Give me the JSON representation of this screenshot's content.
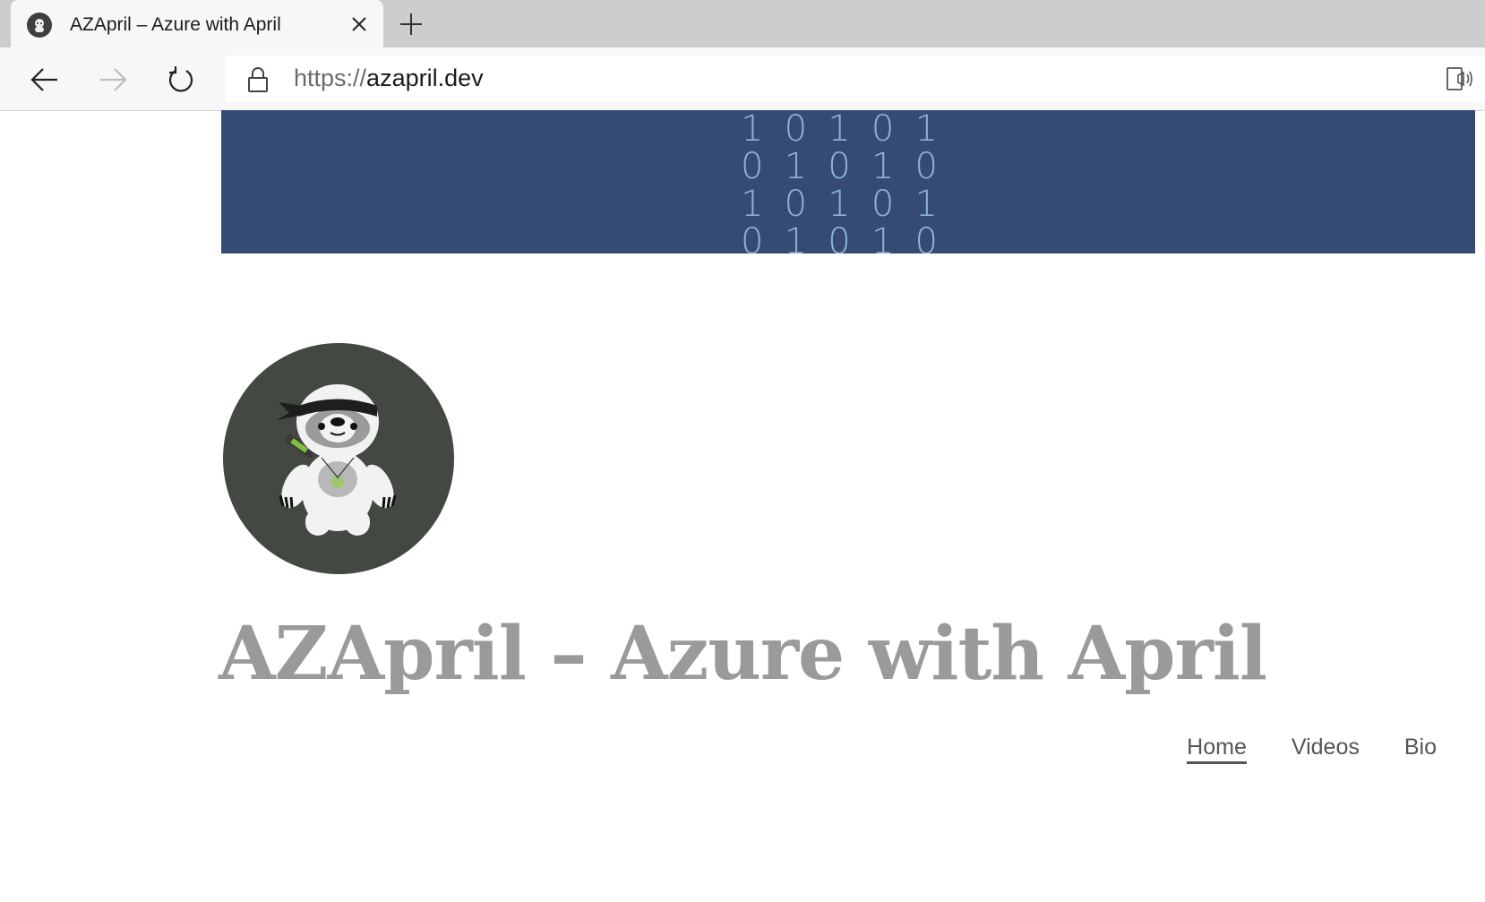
{
  "browser": {
    "tab_title": "AZApril – Azure with April",
    "url_scheme": "https://",
    "url_host": "azapril.dev"
  },
  "banner": {
    "binary_rows": [
      [
        "1",
        "0",
        "1",
        "0",
        "1"
      ],
      [
        "0",
        "1",
        "0",
        "1",
        "0"
      ],
      [
        "1",
        "0",
        "1",
        "0",
        "1"
      ],
      [
        "0",
        "1",
        "0",
        "1",
        "0"
      ]
    ],
    "background_color": "#364b73",
    "digit_color": "#8db4d6"
  },
  "site": {
    "title": "AZApril – Azure with April",
    "title_color": "#9a9a9a",
    "logo_icon": "ninja-sloth-icon"
  },
  "nav": {
    "items": [
      {
        "label": "Home",
        "active": true
      },
      {
        "label": "Videos",
        "active": false
      },
      {
        "label": "Bio",
        "active": false
      }
    ]
  }
}
